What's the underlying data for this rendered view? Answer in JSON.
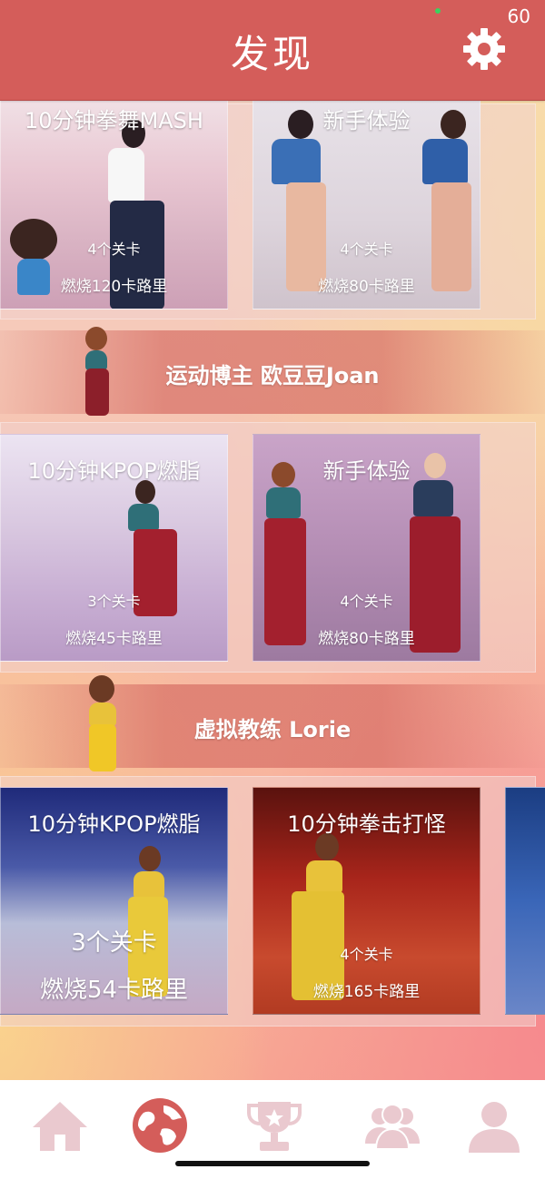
{
  "status": {
    "fps": "60"
  },
  "header": {
    "title": "发现",
    "settings_icon": "gear-icon"
  },
  "sections": [
    {
      "cards": [
        {
          "title": "10分钟拳舞MASH",
          "levels": "4个关卡",
          "calories": "燃烧120卡路里"
        },
        {
          "title": "新手体验",
          "levels": "4个关卡",
          "calories": "燃烧80卡路里"
        }
      ]
    },
    {
      "banner": "运动博主 欧豆豆Joan",
      "cards": [
        {
          "title": "10分钟KPOP燃脂",
          "levels": "3个关卡",
          "calories": "燃烧45卡路里"
        },
        {
          "title": "新手体验",
          "levels": "4个关卡",
          "calories": "燃烧80卡路里"
        }
      ]
    },
    {
      "banner": "虚拟教练 Lorie",
      "cards": [
        {
          "title": "10分钟KPOP燃脂",
          "levels": "3个关卡",
          "calories": "燃烧54卡路里"
        },
        {
          "title": "10分钟拳击打怪",
          "levels": "4个关卡",
          "calories": "燃烧165卡路里"
        }
      ]
    }
  ],
  "tabbar": {
    "tabs": [
      {
        "icon": "home-icon",
        "active": false
      },
      {
        "icon": "globe-icon",
        "active": true
      },
      {
        "icon": "trophy-icon",
        "active": false
      },
      {
        "icon": "group-icon",
        "active": false
      },
      {
        "icon": "user-icon",
        "active": false
      }
    ],
    "active_color": "#d45d5a",
    "inactive_color": "#eac9cf"
  }
}
